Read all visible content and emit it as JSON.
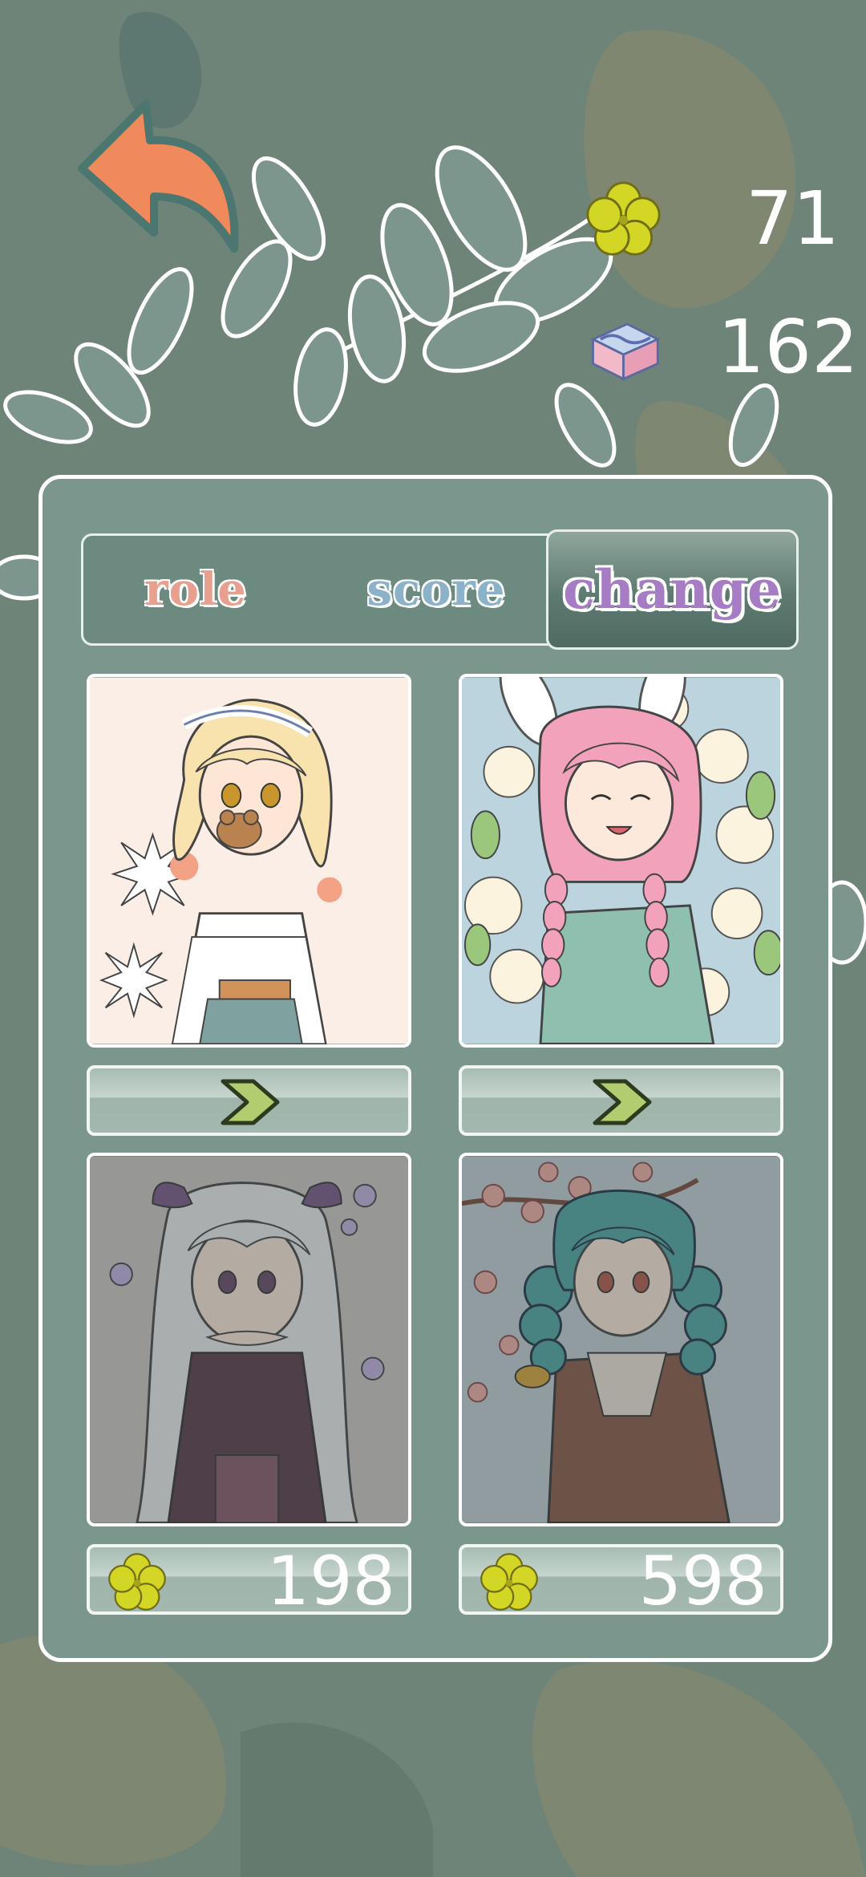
{
  "currencies": [
    {
      "icon": "clover-icon",
      "value": "71"
    },
    {
      "icon": "gem-cube-icon",
      "value": "162"
    }
  ],
  "tabs": [
    {
      "label": "role",
      "active": false
    },
    {
      "label": "score",
      "active": false
    },
    {
      "label": "change",
      "active": true
    }
  ],
  "characters": [
    {
      "name": "blonde-girl-teddy",
      "status": "unlocked",
      "action_icon": "chevron-right-icon"
    },
    {
      "name": "pink-bunny-girl",
      "status": "unlocked",
      "action_icon": "chevron-right-icon"
    },
    {
      "name": "silver-hair-girl",
      "status": "locked",
      "price": "198",
      "price_icon": "clover-icon"
    },
    {
      "name": "teal-twintail-girl",
      "status": "locked",
      "price": "598",
      "price_icon": "clover-icon"
    }
  ],
  "colors": {
    "background": "#6f8478",
    "panel": "#7b978d",
    "back_arrow": "#f08a5d",
    "tab_change": "#a67cc4",
    "tab_role": "#e8a08e",
    "tab_score": "#8bb2c8"
  }
}
